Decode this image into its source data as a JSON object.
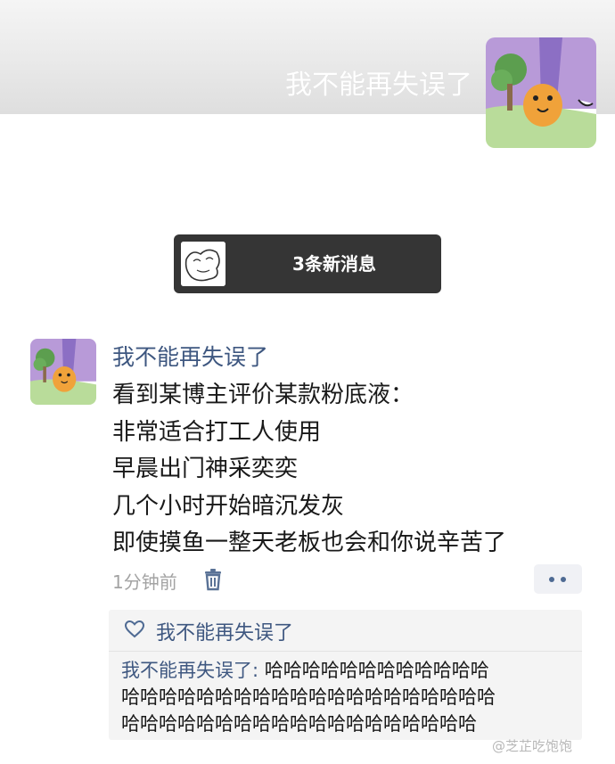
{
  "cover": {
    "name": "我不能再失误了"
  },
  "new_messages": {
    "label": "3条新消息"
  },
  "moment": {
    "author": "我不能再失误了",
    "lines": [
      "看到某博主评价某款粉底液：",
      "非常适合打工人使用",
      "早晨出门神采奕奕",
      "几个小时开始暗沉发灰",
      "即使摸鱼一整天老板也会和你说辛苦了"
    ],
    "time": "1分钟前"
  },
  "interactions": {
    "likes": [
      "我不能再失误了"
    ],
    "comments": [
      {
        "name": "我不能再失误了",
        "separator": ": ",
        "text_lines": [
          "哈哈哈哈哈哈哈哈哈哈哈哈",
          "哈哈哈哈哈哈哈哈哈哈哈哈哈哈哈哈哈哈哈哈",
          "哈哈哈哈哈哈哈哈哈哈哈哈哈哈哈哈哈哈哈"
        ]
      }
    ]
  },
  "watermark": "@芝芷吃饱饱",
  "icons": {
    "trash": "trash-icon",
    "more": "more-dots-icon",
    "like": "heart-icon",
    "weibo": "weibo-logo-icon"
  },
  "colors": {
    "link": "#3e5780",
    "text": "#191919",
    "meta": "#a3a3a3",
    "toast_bg": "#353535",
    "comment_bg": "#f4f4f4"
  }
}
